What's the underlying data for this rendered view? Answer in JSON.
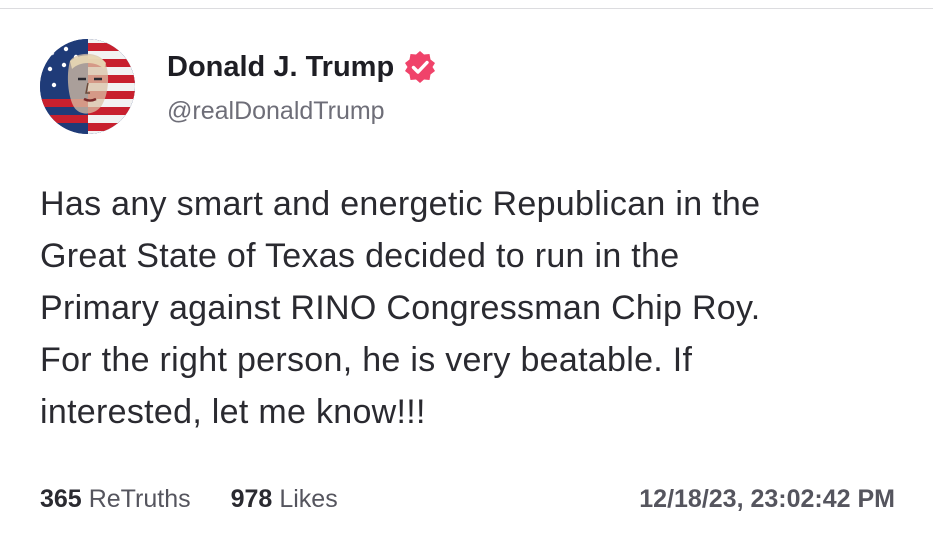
{
  "author": {
    "name": "Donald J. Trump",
    "handle": "@realDonaldTrump",
    "verified_icon": "verified-badge-icon",
    "avatar_icon": "profile-avatar"
  },
  "post": {
    "lines": [
      "Has any smart and energetic Republican in the",
      "Great State of Texas decided to run in the",
      "Primary against RINO Congressman Chip Roy.",
      "For the right person, he is very beatable. If",
      "interested, let me know!!!"
    ]
  },
  "stats": {
    "retruths_count": "365",
    "retruths_label": "ReTruths",
    "likes_count": "978",
    "likes_label": "Likes"
  },
  "timestamp": "12/18/23, 23:02:42 PM",
  "colors": {
    "verified_badge": "#f0436a",
    "text": "#2a2a30",
    "muted": "#6e6e78"
  }
}
